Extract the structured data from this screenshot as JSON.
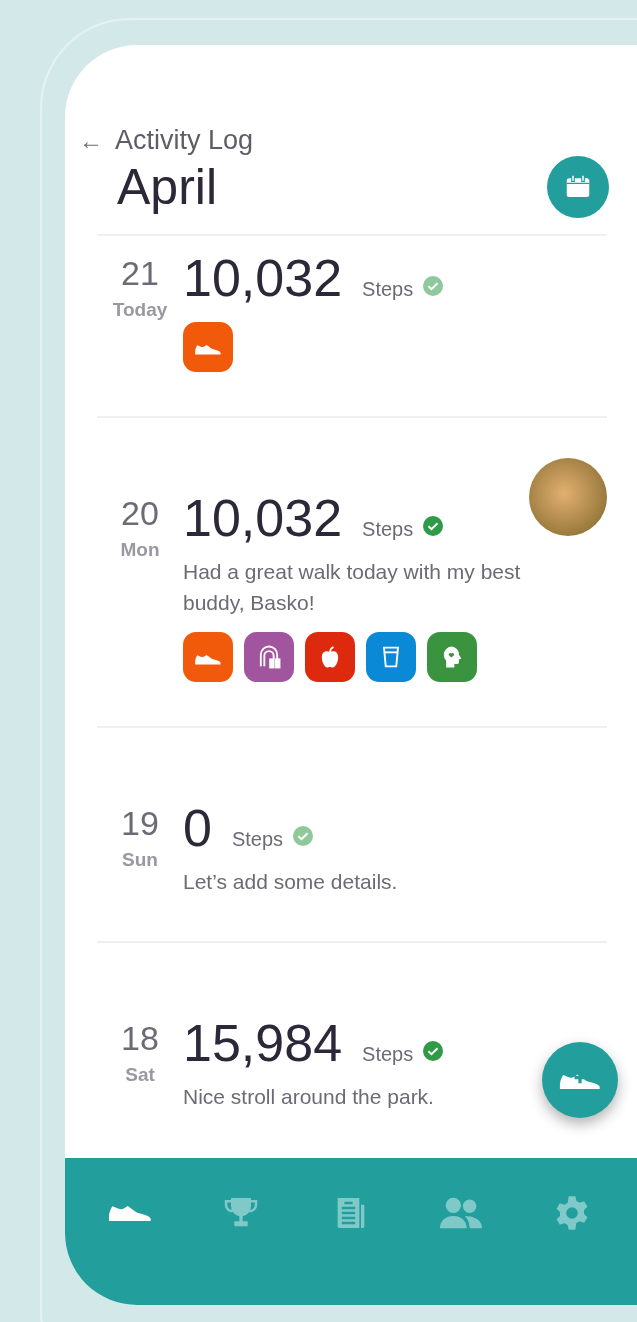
{
  "header": {
    "back": "←",
    "subtitle": "Activity Log",
    "title": "April"
  },
  "entries": [
    {
      "day": "21",
      "weekday": "Today",
      "steps": "10,032",
      "unit": "Steps",
      "color": "#8fc99b",
      "photo": false,
      "activities": [
        {
          "kind": "shoe",
          "color": "#f25a0b"
        }
      ]
    },
    {
      "day": "20",
      "weekday": "Mon",
      "steps": "10,032",
      "unit": "Steps",
      "color": "#2f9a47",
      "note": "Had a great walk today with my best buddy, Basko!",
      "photo": true,
      "activities": [
        {
          "kind": "shoe",
          "color": "#f25a0b"
        },
        {
          "kind": "jumprope",
          "color": "#a2559f"
        },
        {
          "kind": "apple",
          "color": "#dd2a0e"
        },
        {
          "kind": "water",
          "color": "#0a8ad6"
        },
        {
          "kind": "mind",
          "color": "#3a943f"
        }
      ]
    },
    {
      "day": "19",
      "weekday": "Sun",
      "steps": "0",
      "unit": "Steps",
      "color": "#8fc99b",
      "note": "Let’s add some details.",
      "photo": false
    },
    {
      "day": "18",
      "weekday": "Sat",
      "steps": "15,984",
      "unit": "Steps",
      "color": "#2f9a47",
      "note": "Nice stroll around the park.",
      "photo": false
    }
  ],
  "nav": [
    {
      "kind": "shoe",
      "selected": true
    },
    {
      "kind": "trophy",
      "selected": false
    },
    {
      "kind": "news",
      "selected": false
    },
    {
      "kind": "people",
      "selected": false
    },
    {
      "kind": "gear",
      "selected": false
    }
  ]
}
